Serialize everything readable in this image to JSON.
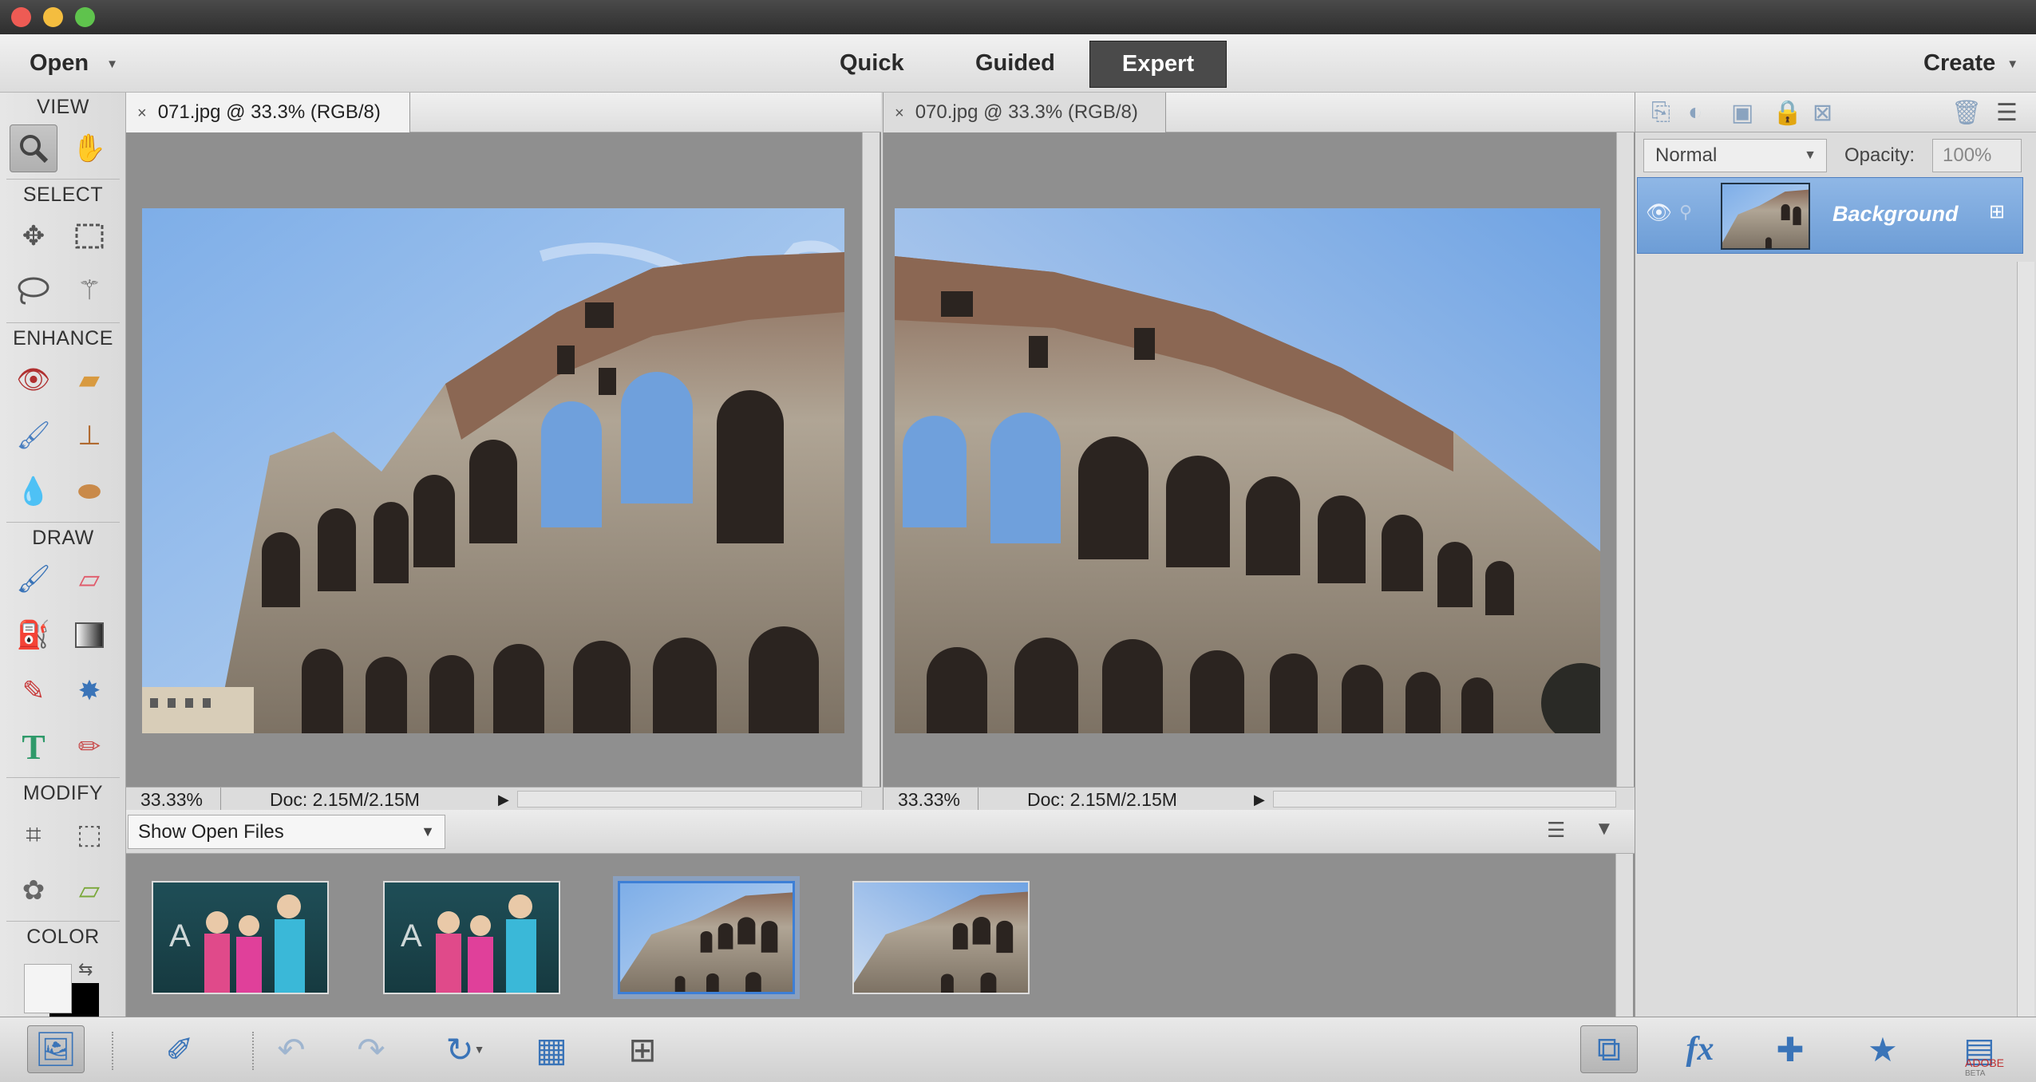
{
  "header": {
    "open_label": "Open",
    "modes": [
      "Quick",
      "Guided",
      "Expert"
    ],
    "active_mode": "Expert",
    "create_label": "Create"
  },
  "toolbox": {
    "sections": {
      "view": "VIEW",
      "select": "SELECT",
      "enhance": "ENHANCE",
      "draw": "DRAW",
      "modify": "MODIFY",
      "color": "COLOR"
    }
  },
  "documents": [
    {
      "tab_label": "071.jpg @ 33.3% (RGB/8)",
      "zoom": "33.33%",
      "doc_size": "Doc: 2.15M/2.15M",
      "active": true
    },
    {
      "tab_label": "070.jpg @ 33.3% (RGB/8)",
      "zoom": "33.33%",
      "doc_size": "Doc: 2.15M/2.15M",
      "active": false
    }
  ],
  "photo_bin": {
    "show_label": "Show Open Files",
    "thumbnails": [
      "girls-photo-1",
      "girls-photo-2",
      "colosseum-071",
      "colosseum-070"
    ],
    "selected_index": 2
  },
  "layers_panel": {
    "blend_mode": "Normal",
    "opacity_label": "Opacity:",
    "opacity_value": "100%",
    "layers": [
      {
        "name": "Background"
      }
    ]
  },
  "watermark": {
    "line1": "ADOBE",
    "line2": "BETA"
  },
  "colors": {
    "accent": "#3a74b8",
    "layer_selected": "#7aa6dc",
    "sky": "#8ab3e6",
    "stone": "#a39686",
    "canvas_bg": "#8f8f8f"
  }
}
